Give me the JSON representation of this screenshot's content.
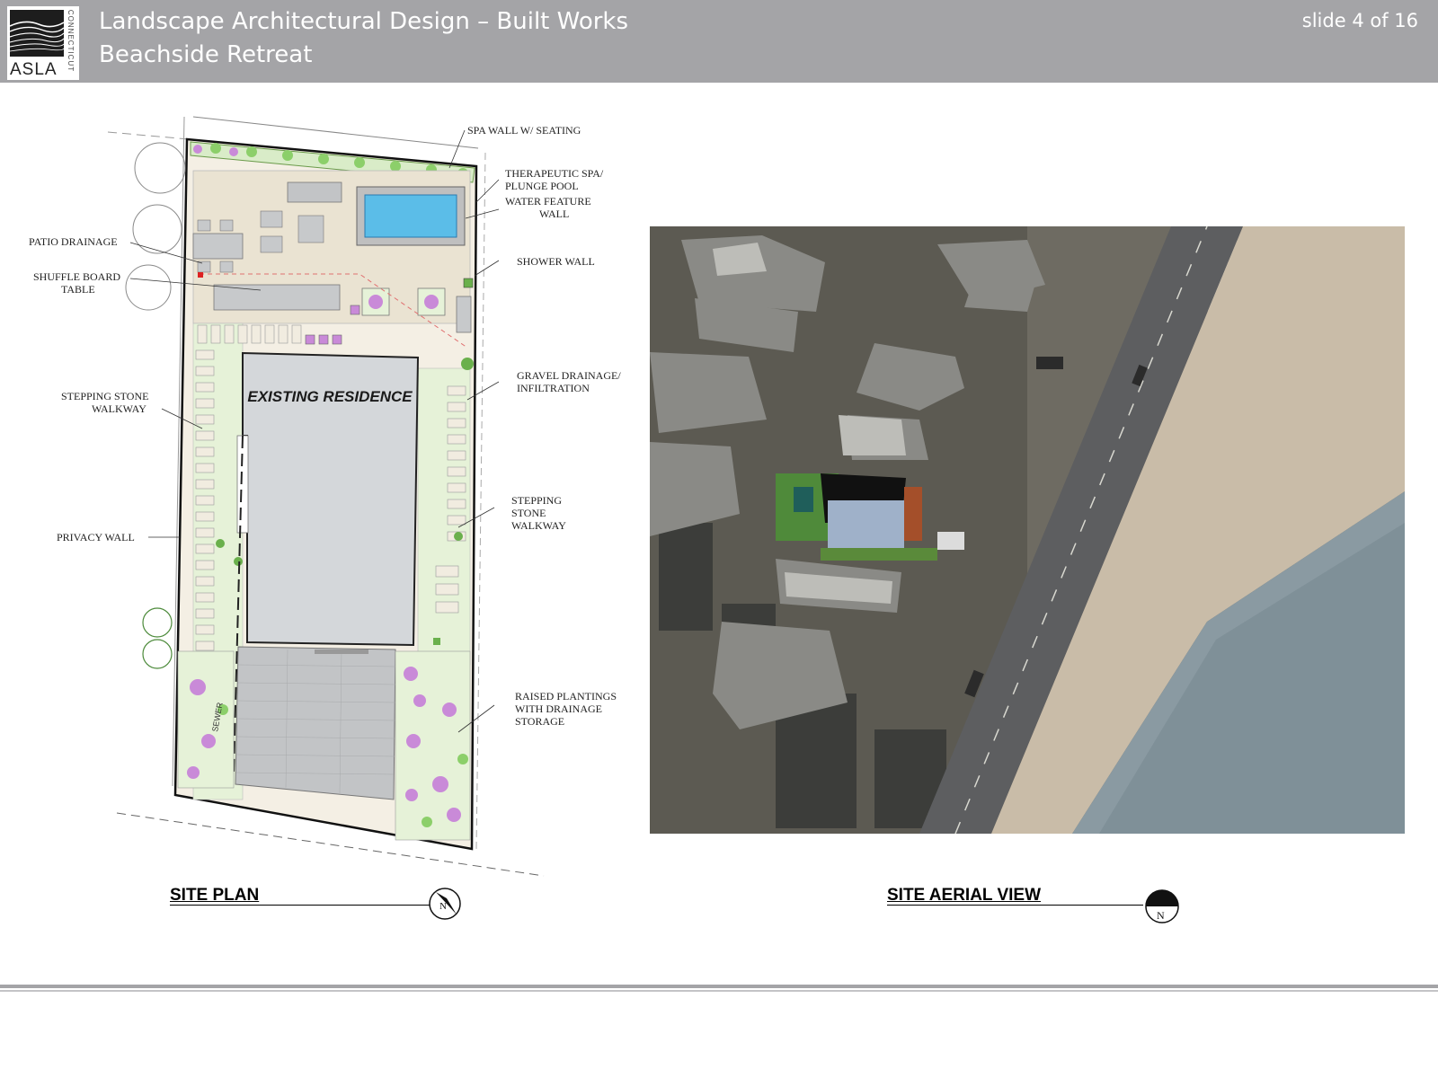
{
  "header": {
    "title_line1": "Landscape Architectural Design – Built Works",
    "title_line2": "Beachside Retreat",
    "slide_counter": "slide 4 of 16",
    "logo_text": "ASLA",
    "logo_subtext": "CONNECTICUT"
  },
  "site_plan": {
    "caption": "SITE PLAN",
    "residence_label": "EXISTING RESIDENCE",
    "sewer_label": "SEWER",
    "north_arrow_label": "N",
    "callouts": {
      "spa_wall": "SPA WALL W/ SEATING",
      "therapeutic_spa_1": "THERAPEUTIC SPA/",
      "therapeutic_spa_2": "PLUNGE POOL",
      "water_feature_1": "WATER FEATURE",
      "water_feature_2": "WALL",
      "patio_drainage": "PATIO DRAINAGE",
      "shuffle_board_1": "SHUFFLE BOARD",
      "shuffle_board_2": "TABLE",
      "shower_wall": "SHOWER WALL",
      "gravel_drainage_1": "GRAVEL DRAINAGE/",
      "gravel_drainage_2": "INFILTRATION",
      "stepping_stone_left_1": "STEPPING STONE",
      "stepping_stone_left_2": "WALKWAY",
      "stepping_stone_right_1": "STEPPING",
      "stepping_stone_right_2": "STONE",
      "stepping_stone_right_3": "WALKWAY",
      "privacy_wall": "PRIVACY WALL",
      "raised_plantings_1": "RAISED PLANTINGS",
      "raised_plantings_2": "WITH DRAINAGE",
      "raised_plantings_3": "STORAGE"
    }
  },
  "aerial_view": {
    "caption": "SITE AERIAL VIEW",
    "north_arrow_label": "N"
  },
  "colors": {
    "header_bg": "#a4a4a7",
    "pool": "#5bbde8",
    "residence": "#d4d7da",
    "patio": "#ede6d6",
    "lawn": "#e6f2d8",
    "planting": "#c98ad8",
    "beach": "#c9bca8",
    "water": "#8a9aa2",
    "road": "#5d5e60"
  }
}
